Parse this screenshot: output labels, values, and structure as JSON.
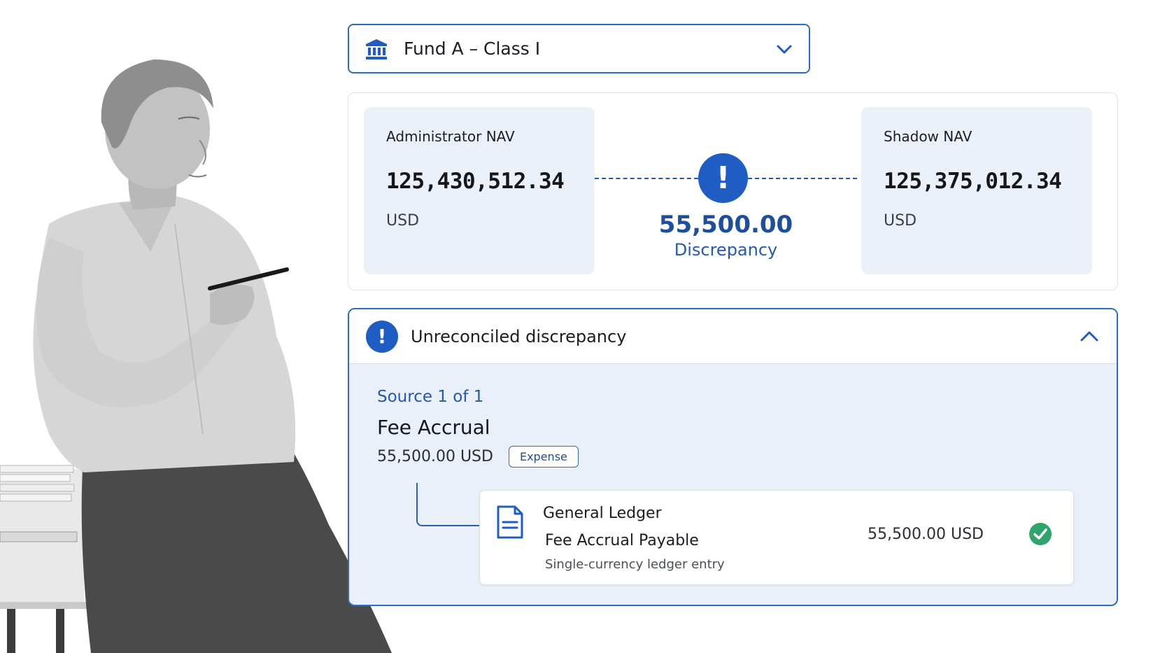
{
  "fund_selector": {
    "label": "Fund A – Class I",
    "icon": "bank-icon"
  },
  "nav_comparison": {
    "administrator": {
      "title": "Administrator NAV",
      "value": "125,430,512.34",
      "currency": "USD"
    },
    "shadow": {
      "title": "Shadow NAV",
      "value": "125,375,012.34",
      "currency": "USD"
    },
    "discrepancy": {
      "value": "55,500.00",
      "label": "Discrepancy"
    }
  },
  "discrepancy_panel": {
    "title": "Unreconciled discrepancy",
    "source_count": "Source 1 of 1",
    "source_name": "Fee Accrual",
    "source_amount": "55,500.00 USD",
    "tag": "Expense",
    "ledger": {
      "title": "General Ledger",
      "account": "Fee Accrual Payable",
      "description": "Single-currency ledger entry",
      "amount": "55,500.00 USD",
      "status": "reconciled"
    }
  },
  "colors": {
    "accent": "#2b6cc4",
    "alert": "#1f5dc4",
    "nav_box_bg": "#ecf1f9",
    "panel_bg": "#eaf0f9",
    "success": "#2fa56b"
  }
}
